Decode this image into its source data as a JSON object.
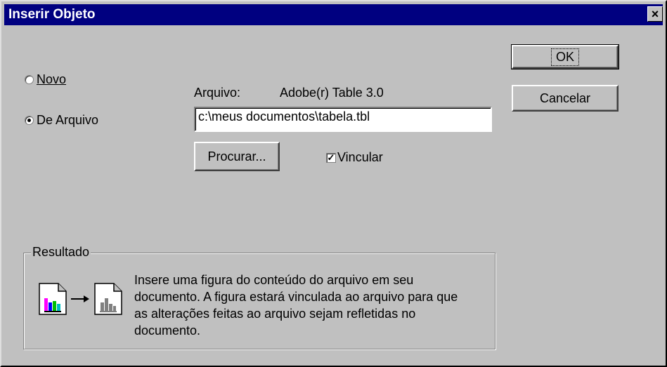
{
  "dialog": {
    "title": "Inserir Objeto",
    "close_label": "×"
  },
  "buttons": {
    "ok_label": "OK",
    "cancel_label": "Cancelar",
    "browse_label": "Procurar..."
  },
  "options": {
    "new_label": "Novo",
    "from_file_label": "De Arquivo",
    "selected": "De Arquivo"
  },
  "file": {
    "label": "Arquivo:",
    "type_value": "Adobe(r) Table 3.0",
    "path_value": "c:\\meus documentos\\tabela.tbl"
  },
  "link": {
    "label": "Vincular",
    "checked": true
  },
  "result": {
    "group_label": "Resultado",
    "text": "Insere uma figura do conteúdo do arquivo em seu documento. A figura estará vinculada ao arquivo para que as alterações feitas ao arquivo sejam refletidas no documento.",
    "icons": [
      "document-chart-icon",
      "arrow-right-icon",
      "document-chart-gray-icon"
    ]
  }
}
